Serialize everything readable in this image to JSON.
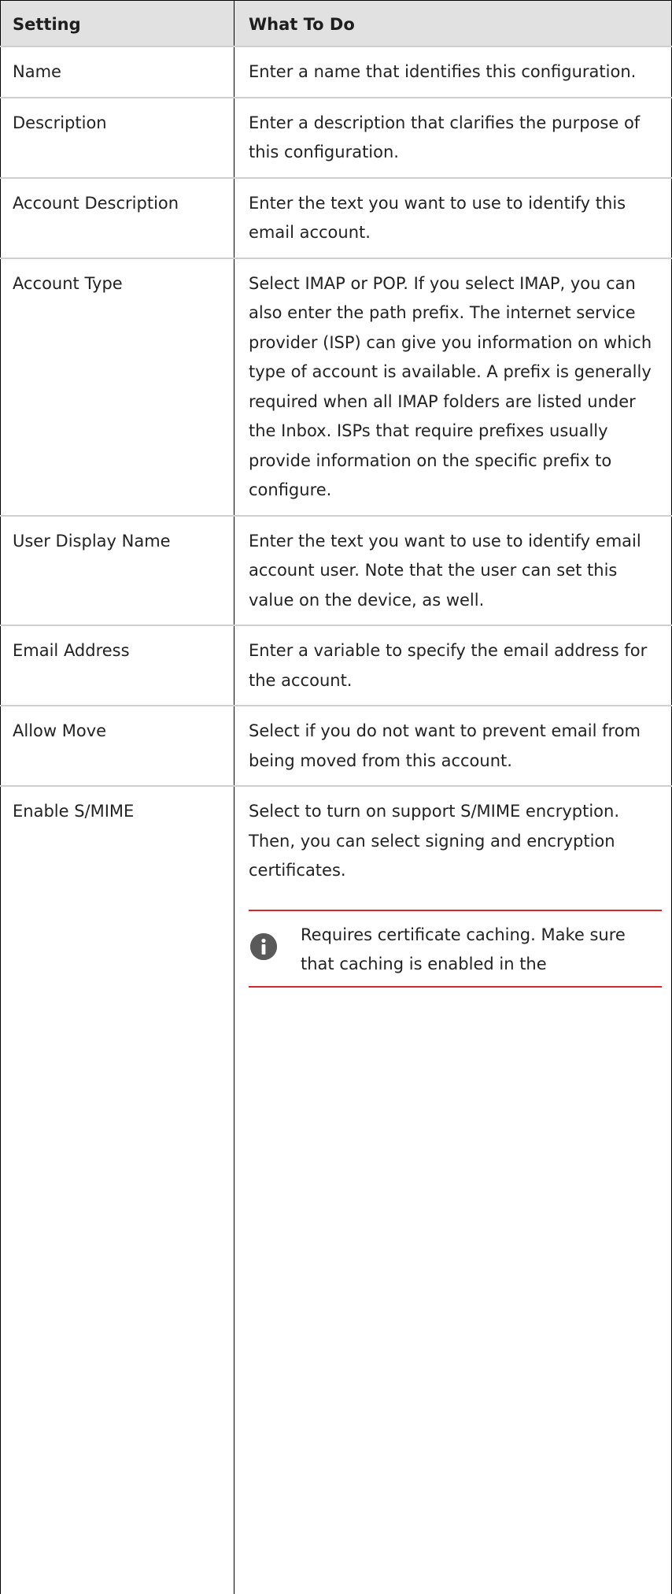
{
  "table": {
    "headers": {
      "setting": "Setting",
      "what_to_do": "What To Do"
    },
    "rows": [
      {
        "setting": "Name",
        "what_to_do": "Enter a name that identifies this configuration."
      },
      {
        "setting": "Description",
        "what_to_do": "Enter a description that clarifies the purpose of this configuration."
      },
      {
        "setting": "Account Description",
        "what_to_do": "Enter the text you want to use to identify this email account."
      },
      {
        "setting": "Account Type",
        "what_to_do": "Select IMAP or POP. If you select IMAP, you can also enter the path prefix. The internet service provider (ISP) can give you information on which type of account is available. A prefix is generally required when all IMAP folders are listed under the Inbox. ISPs that require prefixes usually provide information on the specific prefix to configure."
      },
      {
        "setting": "User Display Name",
        "what_to_do": "Enter the text you want to use to identify email account user. Note that the user can set this value on the device, as well."
      },
      {
        "setting": "Email Address",
        "what_to_do": "Enter a variable to specify the email address for the account."
      },
      {
        "setting": "Allow Move",
        "what_to_do": "Select if you do not want to prevent email from being moved from this account."
      },
      {
        "setting": "Enable S/MIME",
        "what_to_do": "Select to turn on support S/MIME encryption. Then, you can select signing and encryption certificates."
      }
    ],
    "note": {
      "icon": "info-icon",
      "text": "Requires certificate caching. Make sure that caching is enabled in the"
    }
  },
  "colors": {
    "header_bg": "#e1e1e1",
    "row_divider": "#cfcfcf",
    "note_border": "#d9262c",
    "icon_bg": "#5a5a5a"
  }
}
